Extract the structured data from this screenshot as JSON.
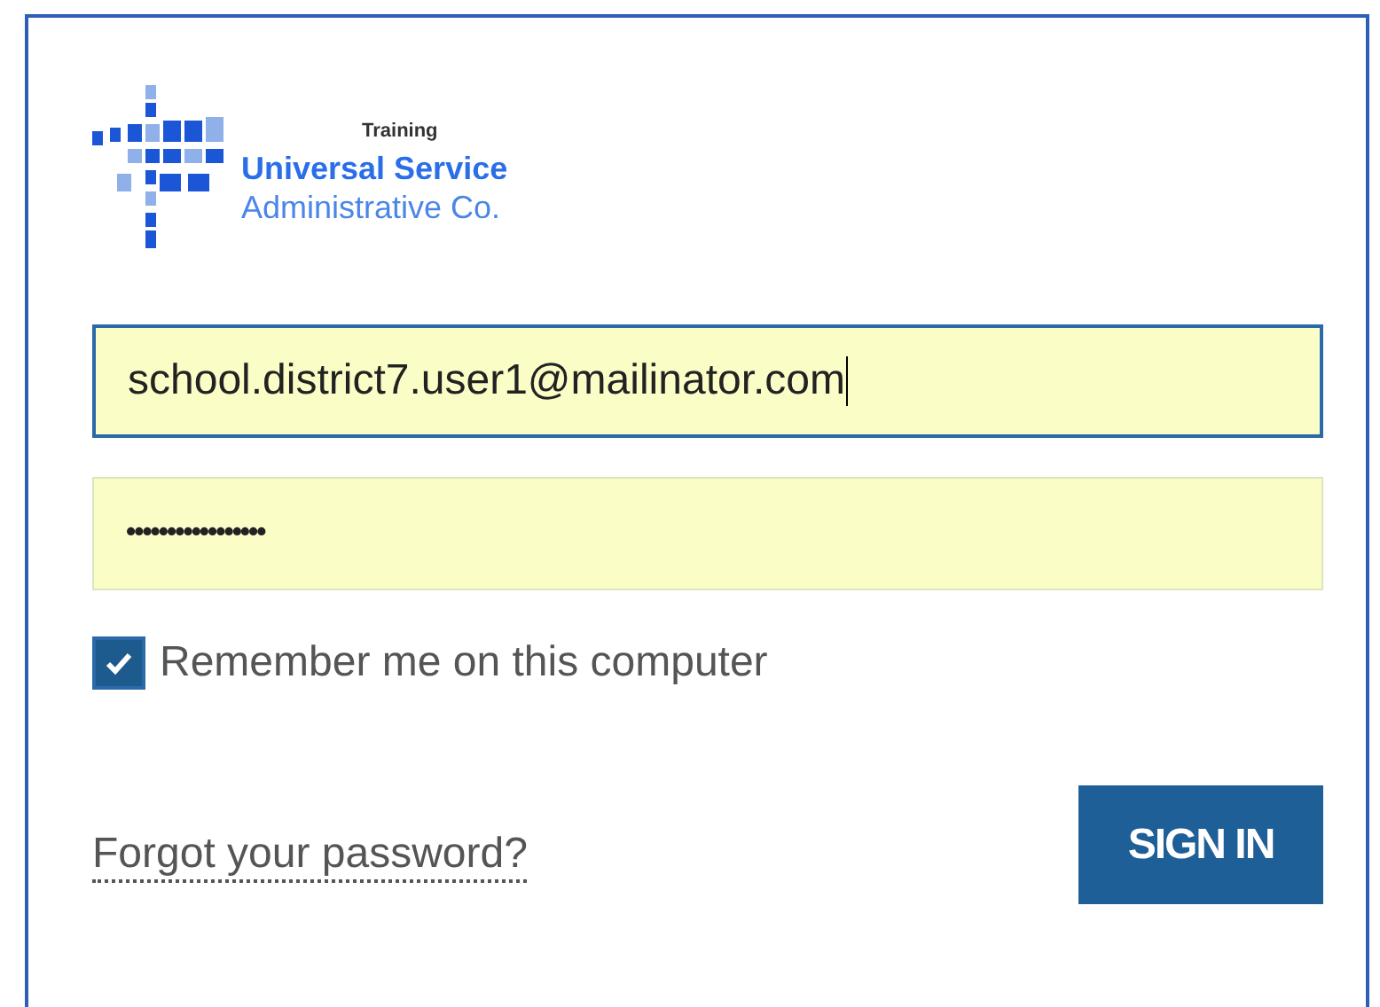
{
  "logo": {
    "badge": "Training",
    "line_1": "Universal Service",
    "line_2": "Administrative Co."
  },
  "email_field": {
    "value": "school.district7.user1@mailinator.com",
    "focused": true
  },
  "password_field": {
    "value": "•••••••••••••••••",
    "focused": false
  },
  "remember": {
    "label": "Remember me on this computer",
    "checked": true
  },
  "forgot_link": "Forgot your password?",
  "sign_in_button": "SIGN IN"
}
